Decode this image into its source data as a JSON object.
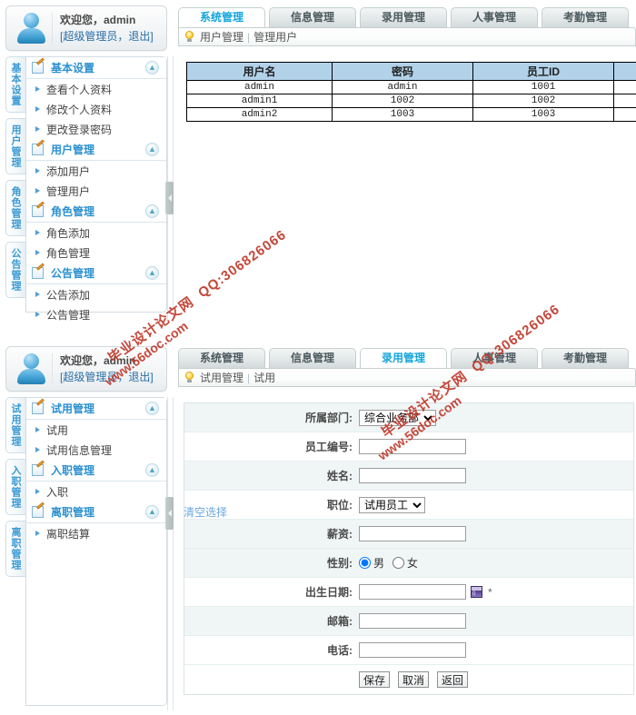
{
  "panels": [
    {
      "welcome": {
        "greeting": "欢迎您，admin",
        "role_logout": "[超级管理员，退出]",
        "avatar_icon": "user-avatar-icon"
      },
      "vtabs": [
        "基本设置",
        "用户管理",
        "角色管理",
        "公告管理"
      ],
      "accordion": [
        {
          "title": "基本设置",
          "icon": "edit-sheet-icon",
          "toggle": "collapse-chevron-icon",
          "items": [
            "查看个人资料",
            "修改个人资料",
            "更改登录密码"
          ]
        },
        {
          "title": "用户管理",
          "icon": "edit-sheet-icon",
          "toggle": "collapse-chevron-icon",
          "items": [
            "添加用户",
            "管理用户"
          ]
        },
        {
          "title": "角色管理",
          "icon": "edit-sheet-icon",
          "toggle": "collapse-chevron-icon",
          "items": [
            "角色添加",
            "角色管理"
          ]
        },
        {
          "title": "公告管理",
          "icon": "edit-sheet-icon",
          "toggle": "collapse-chevron-icon",
          "items": [
            "公告添加",
            "公告管理"
          ]
        }
      ],
      "tabs": [
        {
          "label": "系统管理",
          "active": true
        },
        {
          "label": "信息管理",
          "active": false
        },
        {
          "label": "录用管理",
          "active": false
        },
        {
          "label": "人事管理",
          "active": false
        },
        {
          "label": "考勤管理",
          "active": false
        }
      ],
      "breadcrumb": {
        "icon": "lightbulb-icon",
        "parent": "用户管理",
        "sep": "|",
        "current": "管理用户"
      },
      "table": {
        "columns": [
          "用户名",
          "密码",
          "员工ID",
          ""
        ],
        "rows": [
          [
            "admin",
            "admin",
            "1001",
            ""
          ],
          [
            "admin1",
            "1002",
            "1002",
            ""
          ],
          [
            "admin2",
            "1003",
            "1003",
            ""
          ]
        ]
      }
    },
    {
      "welcome": {
        "greeting": "欢迎您，admin",
        "role_logout": "[超级管理员，退出]",
        "avatar_icon": "user-avatar-icon"
      },
      "vtabs": [
        "试用管理",
        "入职管理",
        "离职管理"
      ],
      "accordion": [
        {
          "title": "试用管理",
          "icon": "edit-sheet-icon",
          "toggle": "collapse-chevron-icon",
          "items": [
            "试用",
            "试用信息管理"
          ]
        },
        {
          "title": "入职管理",
          "icon": "edit-sheet-icon",
          "toggle": "collapse-chevron-icon",
          "items": [
            "入职"
          ]
        },
        {
          "title": "离职管理",
          "icon": "edit-sheet-icon",
          "toggle": "collapse-chevron-icon",
          "items": [
            "离职结算"
          ]
        }
      ],
      "tabs": [
        {
          "label": "系统管理",
          "active": false
        },
        {
          "label": "信息管理",
          "active": false
        },
        {
          "label": "录用管理",
          "active": true
        },
        {
          "label": "人事管理",
          "active": false
        },
        {
          "label": "考勤管理",
          "active": false
        }
      ],
      "breadcrumb": {
        "icon": "lightbulb-icon",
        "parent": "试用管理",
        "sep": "|",
        "current": "试用"
      },
      "clear_selection": "清空选择",
      "form": {
        "rows": [
          {
            "label": "所属部门:",
            "type": "select",
            "value": "综合业务部",
            "options": [
              "综合业务部"
            ],
            "name": "department-select"
          },
          {
            "label": "员工编号:",
            "type": "text",
            "value": "",
            "name": "employee-id-input"
          },
          {
            "label": "姓名:",
            "type": "text",
            "value": "",
            "name": "name-input"
          },
          {
            "label": "职位:",
            "type": "select",
            "value": "试用员工",
            "options": [
              "试用员工"
            ],
            "name": "position-select"
          },
          {
            "label": "薪资:",
            "type": "text",
            "value": "",
            "name": "salary-input"
          },
          {
            "label": "性别:",
            "type": "radio",
            "value": "男",
            "options": [
              "男",
              "女"
            ],
            "name": "gender-radio-group"
          },
          {
            "label": "出生日期:",
            "type": "date",
            "value": "",
            "required_mark": "*",
            "calendar_icon": "calendar-icon",
            "name": "birthdate-input"
          },
          {
            "label": "邮箱:",
            "type": "text",
            "value": "",
            "name": "email-input"
          },
          {
            "label": "电话:",
            "type": "text",
            "value": "",
            "name": "phone-input"
          }
        ],
        "buttons": [
          "保存",
          "取消",
          "返回"
        ]
      }
    }
  ],
  "watermarks": [
    {
      "line1": "毕业设计论文网",
      "line2": "www.56doc.com",
      "line3": "QQ:306826066"
    },
    {
      "line1": "毕业设计论文网",
      "line2": "www.56doc.com",
      "line3": "QQ:306826066"
    }
  ],
  "colors": {
    "accent_active_tab_text": "#15a5dd",
    "accordion_title": "#2b90cf",
    "table_header_bg": "#b2d2ea",
    "watermark": "#c0392b",
    "link": "#6aa7e0"
  }
}
